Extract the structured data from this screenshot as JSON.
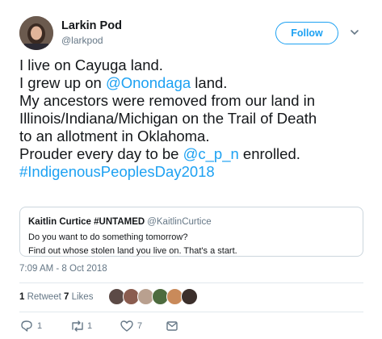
{
  "author": {
    "name": "Larkin Pod",
    "handle": "@larkpod",
    "follow_label": "Follow"
  },
  "tweet": {
    "lines": [
      [
        {
          "t": "I live on Cayuga land."
        }
      ],
      [
        {
          "t": "I grew up on "
        },
        {
          "t": "@Onondaga",
          "link": true
        },
        {
          "t": " land."
        }
      ],
      [
        {
          "t": "My ancestors were removed from our land in"
        }
      ],
      [
        {
          "t": "Illinois/Indiana/Michigan on the Trail of Death"
        }
      ],
      [
        {
          "t": "to an allotment in Oklahoma."
        }
      ],
      [
        {
          "t": "Prouder every day to be "
        },
        {
          "t": "@c_p_n",
          "link": true
        },
        {
          "t": " enrolled."
        }
      ],
      [
        {
          "t": "#IndigenousPeoplesDay2018",
          "link": true
        }
      ]
    ]
  },
  "quote": {
    "name": "Kaitlin Curtice #UNTAMED",
    "handle": "@KaitlinCurtice",
    "line1": "Do you want to do something tomorrow?",
    "line2": "Find out whose stolen land you live on. That's a start."
  },
  "timestamp": "7:09 AM - 8 Oct 2018",
  "stats": {
    "retweets_count": "1",
    "retweets_label": "Retweet",
    "likes_count": "7",
    "likes_label": "Likes"
  },
  "actions": {
    "reply_count": "1",
    "retweet_count": "1",
    "like_count": "7"
  },
  "colors": {
    "link": "#1da1f2",
    "secondary_text": "#657786",
    "border": "#ccd6dd"
  },
  "icons": [
    "caret-down-icon",
    "reply-icon",
    "retweet-icon",
    "heart-icon",
    "message-icon"
  ]
}
